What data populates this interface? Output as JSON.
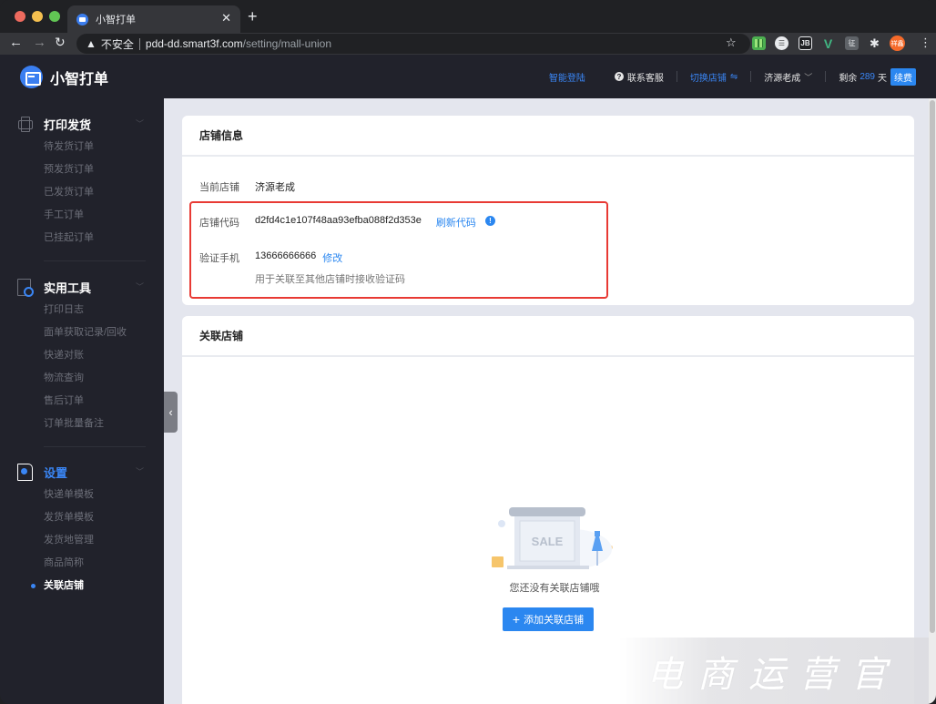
{
  "browser": {
    "tab_title": "小智打单",
    "url_warning": "不安全",
    "url_host": "pdd-dd.smart3f.com",
    "url_path": "/setting/mall-union",
    "extensions": [
      "qr-code-extension",
      "web-extension",
      "jetbrains-extension",
      "vue-devtools-extension",
      "zheng-extension",
      "extensions-puzzle"
    ],
    "profile_avatar_text": "祥鑫"
  },
  "header": {
    "brand": "小智打单",
    "smart_login": "智能登陆",
    "contact_service": "联系客服",
    "switch_shop": "切换店铺",
    "switch_icon": "⇋",
    "current_user": "济源老成",
    "remain_prefix": "剩余",
    "remain_days": "289",
    "remain_suffix": "天",
    "renew": "续费"
  },
  "sidebar": {
    "groups": [
      {
        "title": "打印发货",
        "icon": "printer-icon",
        "items": [
          "待发货订单",
          "预发货订单",
          "已发货订单",
          "手工订单",
          "已挂起订单"
        ]
      },
      {
        "title": "实用工具",
        "icon": "tool-search-icon",
        "items": [
          "打印日志",
          "面单获取记录/回收",
          "快递对账",
          "物流查询",
          "售后订单",
          "订单批量备注"
        ]
      },
      {
        "title": "设置",
        "icon": "settings-doc-icon",
        "active": true,
        "items": [
          "快递单模板",
          "发货单模板",
          "发货地管理",
          "商品简称",
          "关联店铺"
        ],
        "active_item": "关联店铺"
      }
    ]
  },
  "shop_info": {
    "title": "店铺信息",
    "current_shop_label": "当前店铺",
    "current_shop_value": "济源老成",
    "shop_code_label": "店铺代码",
    "shop_code_value": "d2fd4c1e107f48aa93efba088f2d353e",
    "refresh_code": "刷新代码",
    "info_icon": "!",
    "phone_label": "验证手机",
    "phone_value": "13666666666",
    "edit_phone": "修改",
    "phone_hint": "用于关联至其他店铺时接收验证码"
  },
  "linked_shops": {
    "title": "关联店铺",
    "illustration_text": "SALE",
    "empty_text": "您还没有关联店铺哦",
    "add_button": "添加关联店铺",
    "add_icon": "+"
  },
  "watermark": "电商运营官"
}
